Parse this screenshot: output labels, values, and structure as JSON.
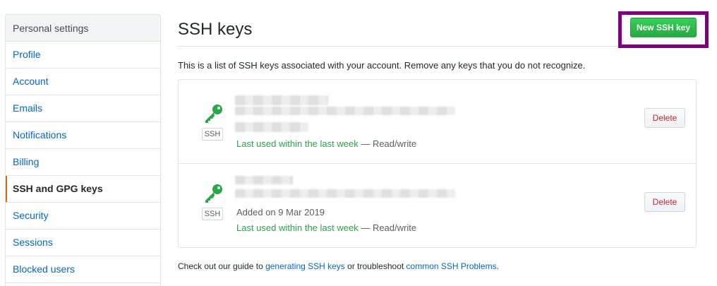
{
  "sidebar": {
    "header": "Personal settings",
    "items": [
      {
        "label": "Profile"
      },
      {
        "label": "Account"
      },
      {
        "label": "Emails"
      },
      {
        "label": "Notifications"
      },
      {
        "label": "Billing"
      },
      {
        "label": "SSH and GPG keys",
        "selected": true
      },
      {
        "label": "Security"
      },
      {
        "label": "Sessions"
      },
      {
        "label": "Blocked users"
      }
    ]
  },
  "main": {
    "title": "SSH keys",
    "new_key_button": "New SSH key",
    "intro": "This is a list of SSH keys associated with your account. Remove any keys that you do not recognize.",
    "keys": [
      {
        "type_badge": "SSH",
        "added": "",
        "last_used": "Last used within the last week",
        "access": " — Read/write",
        "delete_label": "Delete"
      },
      {
        "type_badge": "SSH",
        "added": "Added on 9 Mar 2019",
        "last_used": "Last used within the last week",
        "access": " — Read/write",
        "delete_label": "Delete"
      }
    ],
    "footer": {
      "prefix": "Check out our guide to ",
      "link1": "generating SSH keys",
      "middle": " or troubleshoot ",
      "link2": "common SSH Problems",
      "suffix": "."
    }
  },
  "colors": {
    "accent": "#0366d6",
    "primary_button": "#28a745",
    "danger": "#cb2431",
    "highlight": "#800080",
    "selected_marker": "#e36209"
  },
  "icons": {
    "key": "key-icon"
  }
}
